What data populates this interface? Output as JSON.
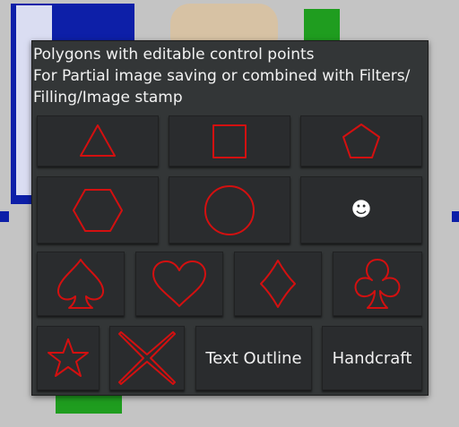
{
  "dialog": {
    "lines": [
      "Polygons with editable control points",
      "For Partial image saving or combined with Filters/",
      "Filling/Image stamp"
    ]
  },
  "shapes": {
    "triangle": {
      "icon": "triangle-icon"
    },
    "square": {
      "icon": "square-icon"
    },
    "pentagon": {
      "icon": "pentagon-icon"
    },
    "hexagon": {
      "icon": "hexagon-icon"
    },
    "circle": {
      "icon": "circle-icon"
    },
    "emoji": {
      "glyph": "☻",
      "icon": "smiley-icon"
    },
    "spade": {
      "icon": "spade-icon"
    },
    "heart": {
      "icon": "heart-icon"
    },
    "diamond": {
      "icon": "diamond-icon"
    },
    "club": {
      "icon": "club-icon"
    },
    "star": {
      "icon": "star-icon"
    },
    "cross": {
      "icon": "cross-icon"
    },
    "text_outline_label": "Text Outline",
    "handcraft_label": "Handcraft"
  },
  "colors": {
    "dialog_bg": "#333637",
    "button_bg": "#2a2c2e",
    "shape_stroke": "#d31010",
    "text": "#f2f2f2"
  }
}
